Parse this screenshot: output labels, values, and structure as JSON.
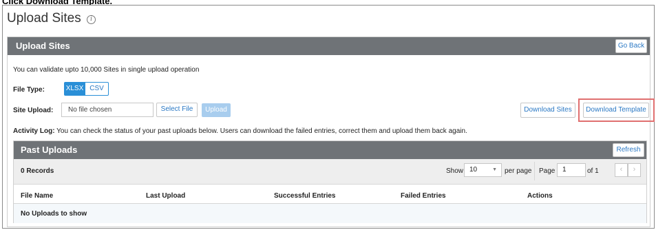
{
  "instruction": {
    "prefix": "Click ",
    "bold": "Download Template."
  },
  "page": {
    "title": "Upload Sites",
    "info_icon": "i"
  },
  "panel": {
    "title": "Upload Sites",
    "go_back": "Go Back",
    "description": "You can validate upto 10,000 Sites in single upload operation",
    "file_type_label": "File Type:",
    "file_types": [
      "XLSX",
      "CSV"
    ],
    "selected_file_type": "XLSX",
    "site_upload_label": "Site Upload:",
    "file_input_value": "No file chosen",
    "select_file": "Select File",
    "upload": "Upload",
    "download_sites": "Download Sites",
    "download_template": "Download Template",
    "activity_label": "Activity Log:",
    "activity_text": " You can check the status of your past uploads below. Users can download the failed entries, correct them and upload them back again."
  },
  "past_uploads": {
    "title": "Past Uploads",
    "refresh": "Refresh",
    "records": "0 Records",
    "show_label": "Show",
    "page_size": "10",
    "per_page_label": "per page",
    "page_label": "Page",
    "page_number": "1",
    "of_label": "of 1",
    "prev_icon": "‹",
    "next_icon": "›",
    "columns": [
      "File Name",
      "Last Upload",
      "Successful Entries",
      "Failed Entries",
      "Actions"
    ],
    "empty_message": "No Uploads to show"
  },
  "colors": {
    "header": "#6f7377",
    "primary": "#2a8fd7",
    "highlight": "#e06f6f"
  }
}
